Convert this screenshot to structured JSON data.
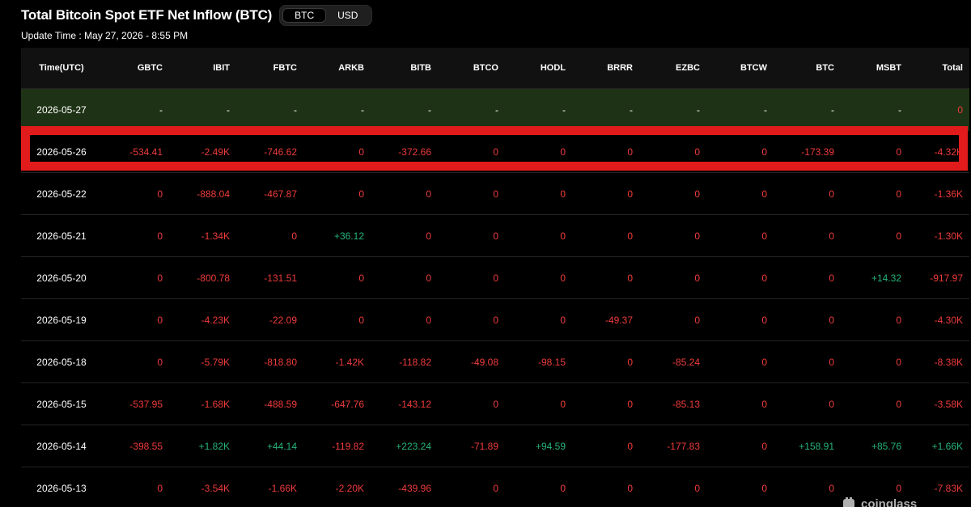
{
  "header": {
    "title": "Total Bitcoin Spot ETF Net Inflow (BTC)",
    "toggle": [
      "BTC",
      "USD"
    ],
    "active_unit": "BTC",
    "update_time": "Update Time : May 27, 2026 - 8:55 PM"
  },
  "table": {
    "columns": [
      "Time(UTC)",
      "GBTC",
      "IBIT",
      "FBTC",
      "ARKB",
      "BITB",
      "BTCO",
      "HODL",
      "BRRR",
      "EZBC",
      "BTCW",
      "BTC",
      "MSBT",
      "Total"
    ],
    "rows": [
      {
        "date": "2026-05-27",
        "cells": [
          "-",
          "-",
          "-",
          "-",
          "-",
          "-",
          "-",
          "-",
          "-",
          "-",
          "-",
          "-",
          "0"
        ]
      },
      {
        "date": "2026-05-26",
        "cells": [
          "-534.41",
          "-2.49K",
          "-746.62",
          "0",
          "-372.66",
          "0",
          "0",
          "0",
          "0",
          "0",
          "-173.39",
          "0",
          "-4.32K"
        ]
      },
      {
        "date": "2026-05-22",
        "cells": [
          "0",
          "-888.04",
          "-467.87",
          "0",
          "0",
          "0",
          "0",
          "0",
          "0",
          "0",
          "0",
          "0",
          "-1.36K"
        ]
      },
      {
        "date": "2026-05-21",
        "cells": [
          "0",
          "-1.34K",
          "0",
          "+36.12",
          "0",
          "0",
          "0",
          "0",
          "0",
          "0",
          "0",
          "0",
          "-1.30K"
        ]
      },
      {
        "date": "2026-05-20",
        "cells": [
          "0",
          "-800.78",
          "-131.51",
          "0",
          "0",
          "0",
          "0",
          "0",
          "0",
          "0",
          "0",
          "+14.32",
          "-917.97"
        ]
      },
      {
        "date": "2026-05-19",
        "cells": [
          "0",
          "-4.23K",
          "-22.09",
          "0",
          "0",
          "0",
          "0",
          "-49.37",
          "0",
          "0",
          "0",
          "0",
          "-4.30K"
        ]
      },
      {
        "date": "2026-05-18",
        "cells": [
          "0",
          "-5.79K",
          "-818.80",
          "-1.42K",
          "-118.82",
          "-49.08",
          "-98.15",
          "0",
          "-85.24",
          "0",
          "0",
          "0",
          "-8.38K"
        ]
      },
      {
        "date": "2026-05-15",
        "cells": [
          "-537.95",
          "-1.68K",
          "-488.59",
          "-647.76",
          "-143.12",
          "0",
          "0",
          "0",
          "-85.13",
          "0",
          "0",
          "0",
          "-3.58K"
        ]
      },
      {
        "date": "2026-05-14",
        "cells": [
          "-398.55",
          "+1.82K",
          "+44.14",
          "-119.82",
          "+223.24",
          "-71.89",
          "+94.59",
          "0",
          "-177.83",
          "0",
          "+158.91",
          "+85.76",
          "+1.66K"
        ]
      },
      {
        "date": "2026-05-13",
        "cells": [
          "0",
          "-3.54K",
          "-1.66K",
          "-2.20K",
          "-439.96",
          "0",
          "0",
          "0",
          "0",
          "0",
          "0",
          "0",
          "-7.83K"
        ]
      }
    ]
  },
  "colors": {
    "negative": "#ef3b3b",
    "positive": "#26b47a",
    "highlight": "#e11b1b",
    "current_row_bg": "#1e3315"
  },
  "watermark": {
    "text": "coinglass"
  }
}
